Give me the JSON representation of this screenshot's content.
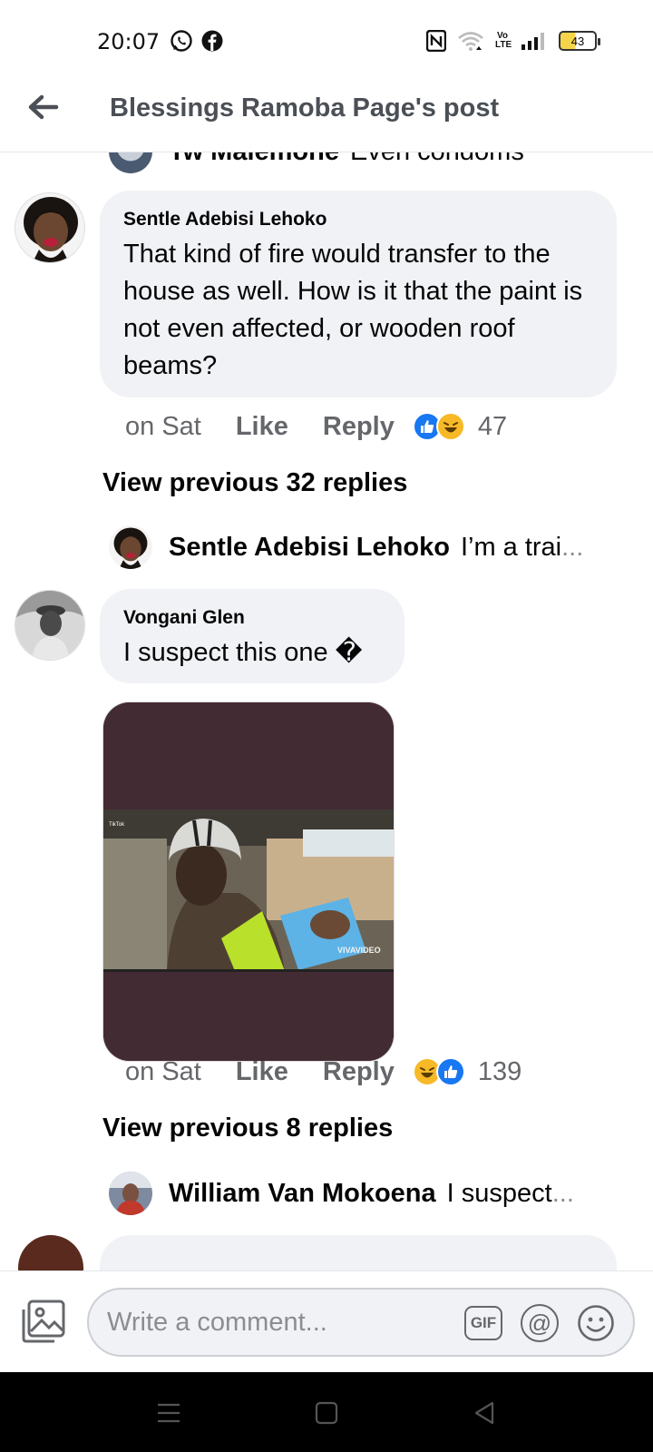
{
  "status_bar": {
    "time": "20:07",
    "battery": "43",
    "left_icons": [
      "whatsapp-icon",
      "facebook-icon"
    ],
    "right_icons": [
      "nfc-icon",
      "wifi-icon",
      "volte-icon",
      "signal-icon",
      "battery-icon"
    ],
    "volte_label": "Vo LTE"
  },
  "header": {
    "title": "Blessings Ramoba Page's post",
    "back_icon": "back-arrow-icon"
  },
  "partial_comment": {
    "author": "Tw Malemone",
    "snippet": "Even condoms"
  },
  "comments": [
    {
      "author": "Sentle Adebisi Lehoko",
      "text": "That kind of fire would transfer to the house as well. How is it that the paint is not even affected, or wooden roof beams?",
      "time": "on Sat",
      "like_label": "Like",
      "reply_label": "Reply",
      "reactions": [
        "like",
        "haha"
      ],
      "reaction_count": "47",
      "view_previous": "View previous 32 replies",
      "latest_reply": {
        "author": "Sentle Adebisi Lehoko",
        "snippet": "I’m a trai",
        "ellipsis": "..."
      }
    },
    {
      "author": "Vongani Glen",
      "text": "I suspect this one �",
      "time": "on Sat",
      "like_label": "Like",
      "reply_label": "Reply",
      "reactions": [
        "haha",
        "like"
      ],
      "reaction_count": "139",
      "view_previous": "View previous 8 replies",
      "media": {
        "watermark_top": "TikTok",
        "watermark_bottom": "VIVAVIDEO"
      },
      "latest_reply": {
        "author": "William Van Mokoena",
        "snippet": "I suspect",
        "ellipsis": "..."
      }
    }
  ],
  "composer": {
    "placeholder": "Write a comment...",
    "gif_label": "GIF",
    "at_label": "@"
  },
  "colors": {
    "bubble": "#f0f2f5",
    "secondary_text": "#65676b",
    "like_blue": "#1877f2",
    "haha_yellow": "#f7b928"
  }
}
